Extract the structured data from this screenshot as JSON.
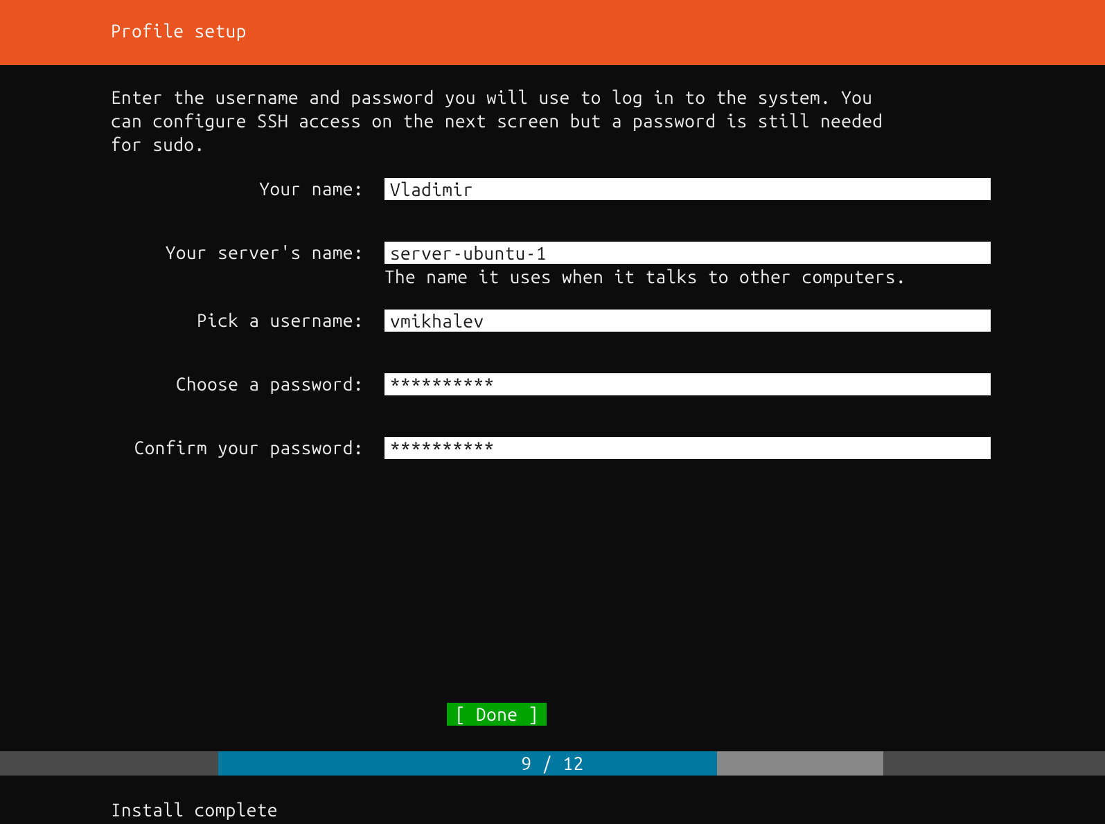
{
  "header": {
    "title": "Profile setup"
  },
  "intro": "Enter the username and password you will use to log in to the system. You can configure SSH access on the next screen but a password is still needed for sudo.",
  "form": {
    "name": {
      "label": "Your name:",
      "value": "Vladimir"
    },
    "server": {
      "label": "Your server's name:",
      "value": "server-ubuntu-1",
      "hint": "The name it uses when it talks to other computers."
    },
    "username": {
      "label": "Pick a username:",
      "value": "vmikhalev"
    },
    "password": {
      "label": "Choose a password:",
      "value": "**********"
    },
    "confirm": {
      "label": "Confirm your password:",
      "value": "**********"
    }
  },
  "buttons": {
    "done": "[ Done       ]"
  },
  "progress": {
    "current": 9,
    "total": 12,
    "text": "9 / 12"
  },
  "status": "Install complete"
}
